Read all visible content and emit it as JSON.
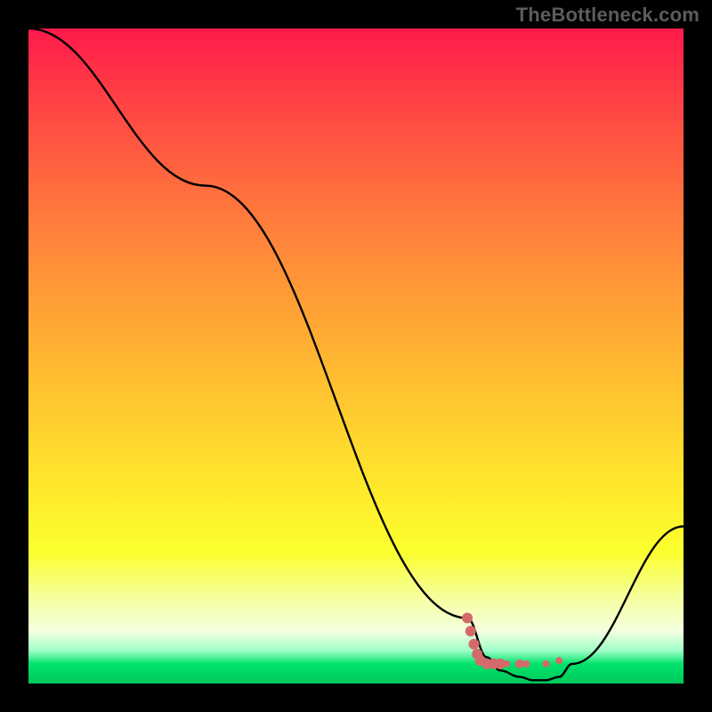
{
  "watermark": "TheBottleneck.com",
  "chart_data": {
    "type": "line",
    "title": "",
    "xlabel": "",
    "ylabel": "",
    "ylim": [
      0,
      100
    ],
    "xlim": [
      0,
      100
    ],
    "series": [
      {
        "name": "bottleneck-curve",
        "x": [
          0,
          27,
          67,
          70,
          72,
          75,
          77,
          79,
          81,
          83,
          100
        ],
        "values": [
          100,
          76,
          10,
          4,
          2,
          1,
          0.5,
          0.5,
          1,
          3,
          24
        ]
      }
    ],
    "markers": {
      "name": "highlight-points",
      "color": "#d46a6a",
      "points": [
        {
          "x": 67,
          "y": 10,
          "r": 6
        },
        {
          "x": 67.5,
          "y": 8,
          "r": 6
        },
        {
          "x": 68,
          "y": 6,
          "r": 6
        },
        {
          "x": 68.5,
          "y": 4.5,
          "r": 6
        },
        {
          "x": 69,
          "y": 3.5,
          "r": 6
        },
        {
          "x": 70,
          "y": 3,
          "r": 6
        },
        {
          "x": 71,
          "y": 3,
          "r": 6
        },
        {
          "x": 72,
          "y": 3,
          "r": 6
        },
        {
          "x": 73,
          "y": 3,
          "r": 4
        },
        {
          "x": 75,
          "y": 3,
          "r": 5
        },
        {
          "x": 76,
          "y": 3,
          "r": 4
        },
        {
          "x": 79,
          "y": 3,
          "r": 4
        },
        {
          "x": 81,
          "y": 3.5,
          "r": 4
        }
      ]
    },
    "gradient_stops": [
      {
        "pos": 0,
        "color": "#ff1a4b"
      },
      {
        "pos": 10,
        "color": "#ff3e45"
      },
      {
        "pos": 25,
        "color": "#ff6f3e"
      },
      {
        "pos": 40,
        "color": "#ff9a36"
      },
      {
        "pos": 55,
        "color": "#ffc230"
      },
      {
        "pos": 70,
        "color": "#ffe82c"
      },
      {
        "pos": 80,
        "color": "#fbff2e"
      },
      {
        "pos": 87,
        "color": "#f6ffa0"
      },
      {
        "pos": 92,
        "color": "#f3ffe0"
      },
      {
        "pos": 95,
        "color": "#9fffc8"
      },
      {
        "pos": 97,
        "color": "#00e36a"
      },
      {
        "pos": 100,
        "color": "#00c95c"
      }
    ]
  }
}
